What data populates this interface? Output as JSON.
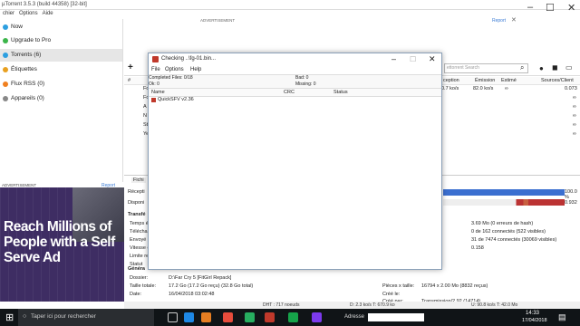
{
  "window": {
    "title": "µTorrent 3.5.3  (build 44358) [32-bit]"
  },
  "menu": [
    "chier",
    "Options",
    "Aide"
  ],
  "sidebar": {
    "items": [
      {
        "label": "Now",
        "color": "#2d9fe0"
      },
      {
        "label": "Upgrade to Pro",
        "color": "#3bb54a"
      },
      {
        "label": "Torrents (6)",
        "color": "#2d9fe0"
      },
      {
        "label": "Étiquettes",
        "color": "#e8a020"
      },
      {
        "label": "Flux RSS (0)",
        "color": "#f08020"
      },
      {
        "label": "Appareils (0)",
        "color": "#888888"
      }
    ]
  },
  "ads": {
    "top_label": "ADVERTISEMENT",
    "report": "Report",
    "left_label": "ADVERTISEMENT",
    "left_headline": "Reach Millions of People with a Self Serve Ad"
  },
  "toolbar": {
    "search_placeholder": "ettorrent Search"
  },
  "list": {
    "headers": [
      "#",
      "ception",
      "Émission",
      "Estimé",
      "Sources/Client"
    ],
    "first_char": [
      "Fc",
      "Fc",
      "A",
      "N",
      "St",
      "Ye"
    ],
    "rows": [
      {
        "reception": "0.7 ko/s",
        "emission": "82.0 ko/s",
        "eta": "∞",
        "sources": "0.073"
      },
      {
        "reception": "",
        "emission": "",
        "eta": "",
        "sources": "∞"
      },
      {
        "reception": "",
        "emission": "",
        "eta": "",
        "sources": "∞"
      },
      {
        "reception": "",
        "emission": "",
        "eta": "",
        "sources": "∞"
      },
      {
        "reception": "",
        "emission": "",
        "eta": "",
        "sources": "∞"
      },
      {
        "reception": "",
        "emission": "",
        "eta": "",
        "sources": "∞"
      }
    ]
  },
  "detail": {
    "tab": "Fichi",
    "received_label": "Récepti",
    "available_label": "Disponi",
    "received_value": "100.0 %",
    "available_value": "0.932",
    "section_transfer": "Transfé",
    "left_labels": [
      "Temps é",
      "Téléchar",
      "Envoyé",
      "Vitesse d",
      "Limite re",
      "Statut"
    ],
    "right_values": [
      "3.69 Mo (0 erreurs de hash)",
      "0 de 162 connectés (522 visibles)",
      "31 de 7474 connectés (30069 visibles)",
      "0.158"
    ],
    "section_general": "Généra",
    "general": [
      {
        "label": "Dossier:",
        "value": "D:\\Far Cry 5 [FitGirl Repack]"
      },
      {
        "label": "Taille totale:",
        "value": "17.2 Go (17.2 Go reçu) (32.8 Go total)"
      },
      {
        "label": "Date:",
        "value": "16/04/2018 03:02:48"
      }
    ],
    "general_right": [
      {
        "label": "Pièces x taille:",
        "value": "16794 x 2.00 Mo (8832 reçus)"
      },
      {
        "label": "Créé le:",
        "value": ""
      },
      {
        "label": "Créé par:",
        "value": "Transmission/2.92 (14714)"
      }
    ]
  },
  "status": {
    "dht": "DHT : 717 noeuds",
    "down": "D: 2.3 ko/s T: 670.9 ko",
    "up": "U: 90.8 ko/s T: 42.0 Mo"
  },
  "dialog": {
    "title": "Checking ..\\fg-01.bin...",
    "menu": [
      "File",
      "Options",
      "Help"
    ],
    "completed": "Completed Files: 0/18",
    "ok": "Ok: 0",
    "bad": "Bad: 0",
    "missing": "Missing: 0",
    "columns": [
      "Name",
      "CRC",
      "Status"
    ],
    "item": "QuickSFV v2.36"
  },
  "taskbar": {
    "search_placeholder": "Taper ici pour rechercher",
    "address_label": "Adresse",
    "time": "14:33",
    "date": "17/04/2018"
  }
}
